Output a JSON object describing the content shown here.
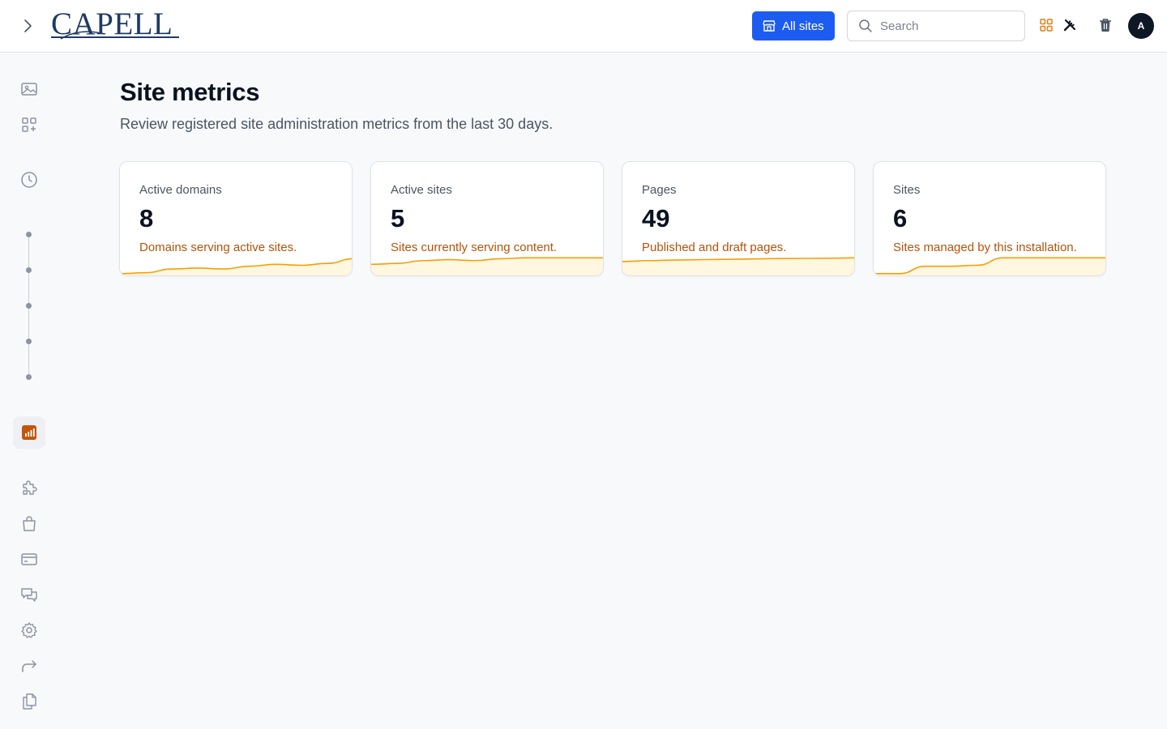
{
  "header": {
    "logo_text": "CAPELL",
    "all_sites_label": "All sites",
    "search_placeholder": "Search",
    "avatar_initial": "A"
  },
  "page": {
    "title": "Site metrics",
    "subtitle": "Review registered site administration metrics from the last 30 days."
  },
  "cards": [
    {
      "label": "Active domains",
      "value": "8",
      "description": "Domains serving active sites.",
      "trend": [
        0.05,
        0.1,
        0.3,
        0.35,
        0.3,
        0.45,
        0.55,
        0.5,
        0.6,
        0.85
      ]
    },
    {
      "label": "Active sites",
      "value": "5",
      "description": "Sites currently serving content.",
      "trend": [
        0.55,
        0.6,
        0.75,
        0.8,
        0.75,
        0.85,
        0.9,
        0.9,
        0.9,
        0.9
      ]
    },
    {
      "label": "Pages",
      "value": "49",
      "description": "Published and draft pages.",
      "trend": [
        0.7,
        0.75,
        0.78,
        0.8,
        0.82,
        0.84,
        0.86,
        0.87,
        0.88,
        0.9
      ]
    },
    {
      "label": "Sites",
      "value": "6",
      "description": "Sites managed by this installation.",
      "trend": [
        0.05,
        0.05,
        0.45,
        0.45,
        0.5,
        0.9,
        0.9,
        0.9,
        0.9,
        0.9
      ]
    }
  ],
  "colors": {
    "accent_blue": "#1d5cf0",
    "trend_line": "#f59e0b",
    "trend_fill": "#fff7df",
    "description_text": "#b45309",
    "active_nav_icon": "#c2560c"
  }
}
